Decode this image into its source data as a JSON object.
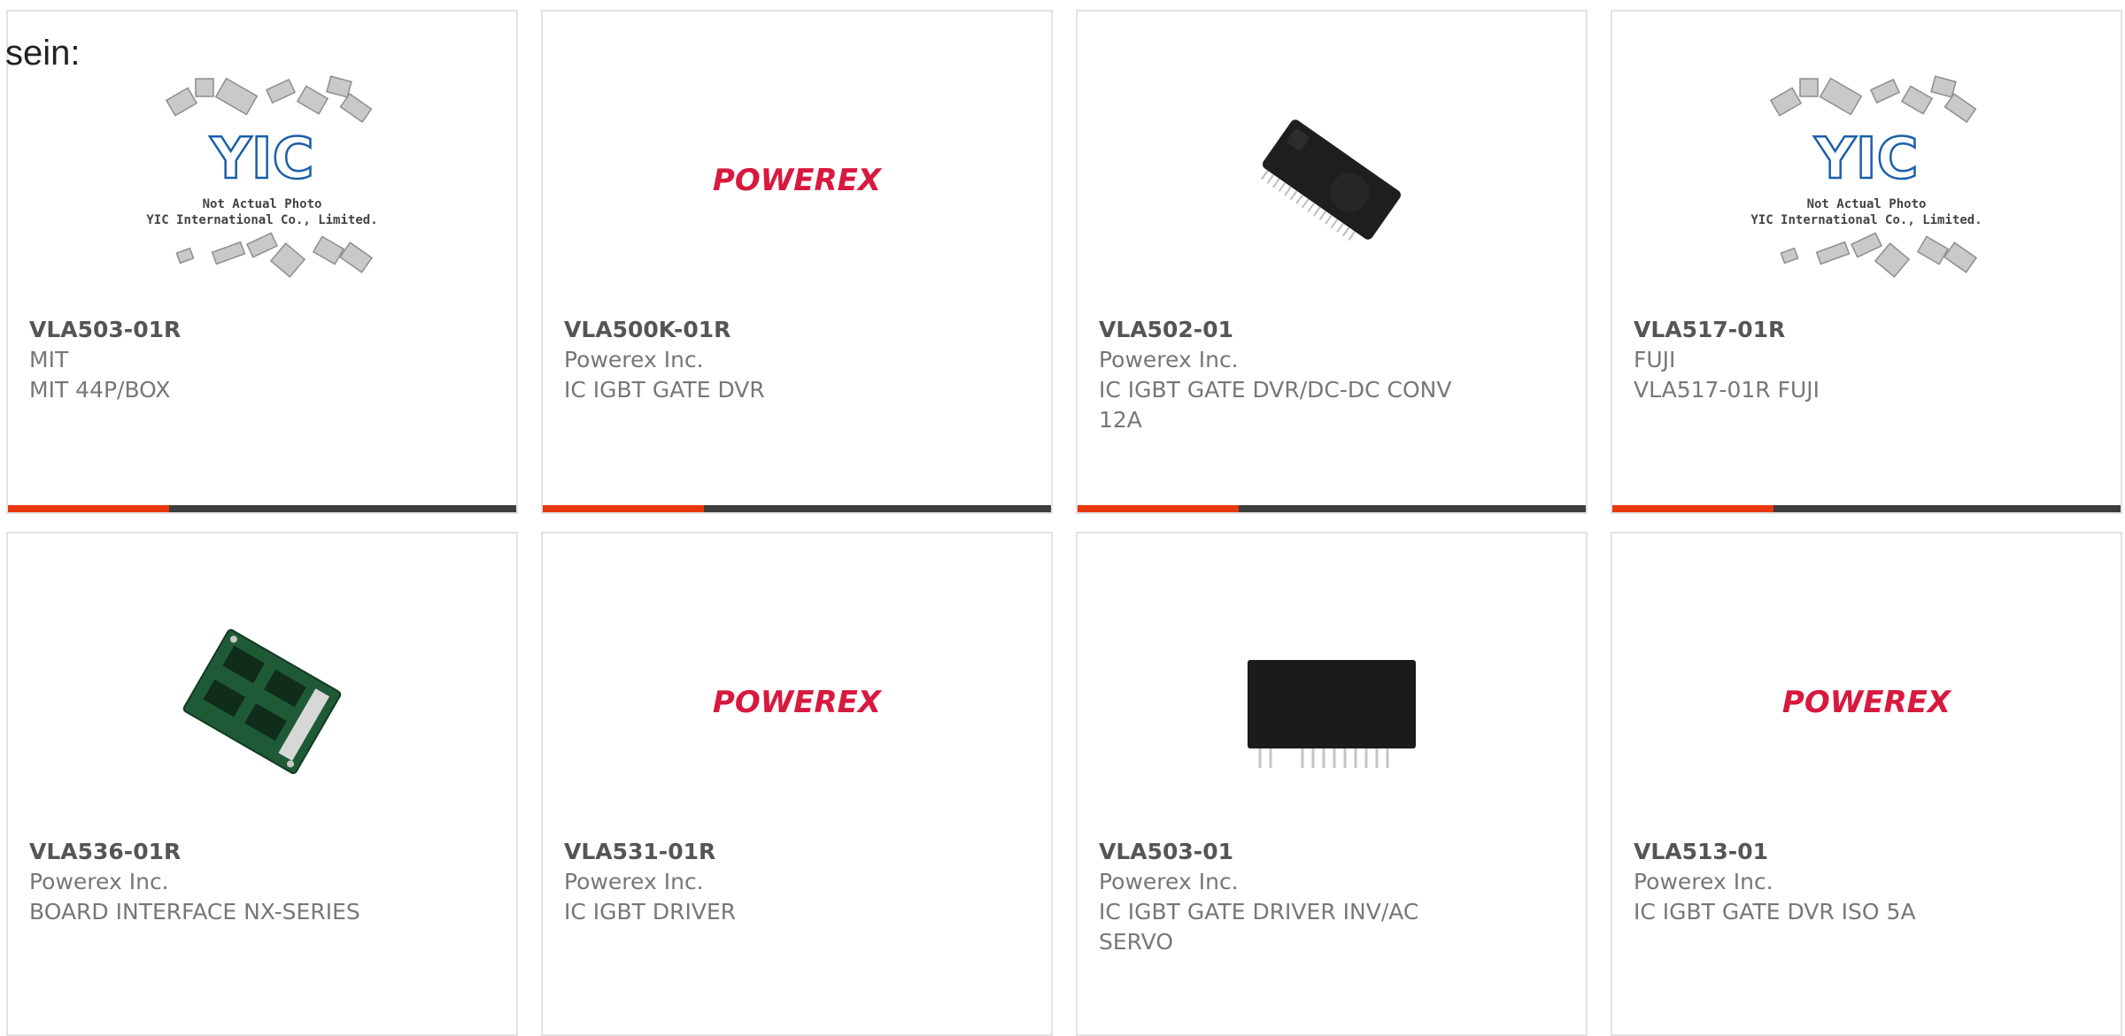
{
  "intro_text": "sein:",
  "products": [
    {
      "part_number": "VLA503-01R",
      "manufacturer": "MIT",
      "description": "MIT 44P/BOX",
      "image": "placeholder",
      "placeholder_lines": [
        "Not Actual Photo",
        "YIC International Co., Limited."
      ],
      "placeholder_logo": "YIC"
    },
    {
      "part_number": "VLA500K-01R",
      "manufacturer": "Powerex Inc.",
      "description": "IC IGBT GATE DVR",
      "image": "powerex-logo",
      "logo_text": "POWEREX"
    },
    {
      "part_number": "VLA502-01",
      "manufacturer": "Powerex Inc.",
      "description": "IC IGBT GATE DVR/DC-DC CONV 12A",
      "image": "chip-module"
    },
    {
      "part_number": "VLA517-01R",
      "manufacturer": "FUJI",
      "description": "VLA517-01R FUJI",
      "image": "placeholder",
      "placeholder_lines": [
        "Not Actual Photo",
        "YIC International Co., Limited."
      ],
      "placeholder_logo": "YIC"
    },
    {
      "part_number": "VLA536-01R",
      "manufacturer": "Powerex Inc.",
      "description": "BOARD INTERFACE NX-SERIES",
      "image": "pcb-board"
    },
    {
      "part_number": "VLA531-01R",
      "manufacturer": "Powerex Inc.",
      "description": "IC IGBT DRIVER",
      "image": "powerex-logo",
      "logo_text": "POWEREX"
    },
    {
      "part_number": "VLA503-01",
      "manufacturer": "Powerex Inc.",
      "description": "IC IGBT GATE DRIVER INV/AC SERVO",
      "image": "sip-module"
    },
    {
      "part_number": "VLA513-01",
      "manufacturer": "Powerex Inc.",
      "description": "IC IGBT GATE DVR ISO 5A",
      "image": "powerex-logo",
      "logo_text": "POWEREX"
    }
  ],
  "colors": {
    "accent": "#e8380d",
    "bar": "#3d3d3d",
    "logo_red": "#d8193f",
    "yic_blue": "#1b5fa8"
  }
}
